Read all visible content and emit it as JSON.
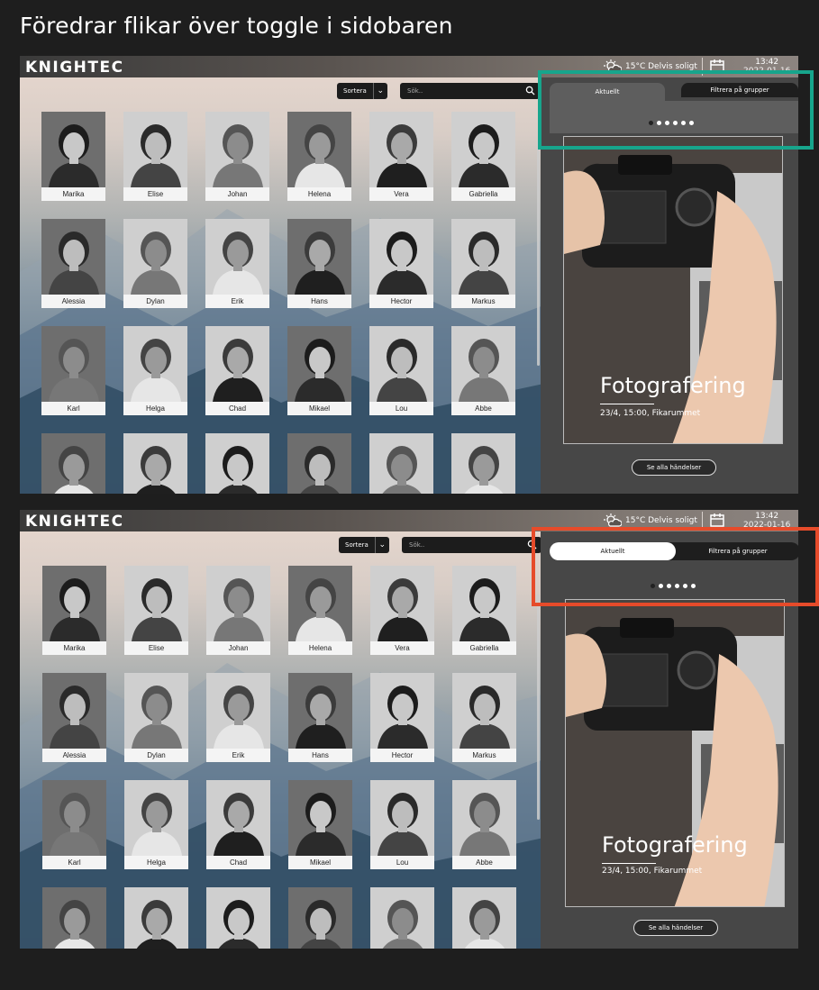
{
  "heading": "Föredrar flikar över toggle i sidobaren",
  "header": {
    "logo": "KNIGHTEC",
    "weather": "15°C Delvis soligt",
    "time": "13:42",
    "date": "2022-01-16"
  },
  "toolbar": {
    "sort_label": "Sortera",
    "search_placeholder": "Sök.."
  },
  "people": [
    "Marika",
    "Elise",
    "Johan",
    "Helena",
    "Vera",
    "Gabriella",
    "Alessia",
    "Dylan",
    "Erik",
    "Hans",
    "Hector",
    "Markus",
    "Karl",
    "Helga",
    "Chad",
    "Mikael",
    "Lou",
    "Abbe",
    "",
    "",
    "",
    "",
    "",
    ""
  ],
  "sidebar": {
    "tab_current": "Aktuellt",
    "tab_filter": "Filtrera på grupper",
    "carousel_count": 6,
    "carousel_active": 1,
    "event": {
      "title": "Fotografering",
      "subtitle": "23/4, 15:00, Fikarummet"
    },
    "see_all": "Se alla händelser"
  }
}
